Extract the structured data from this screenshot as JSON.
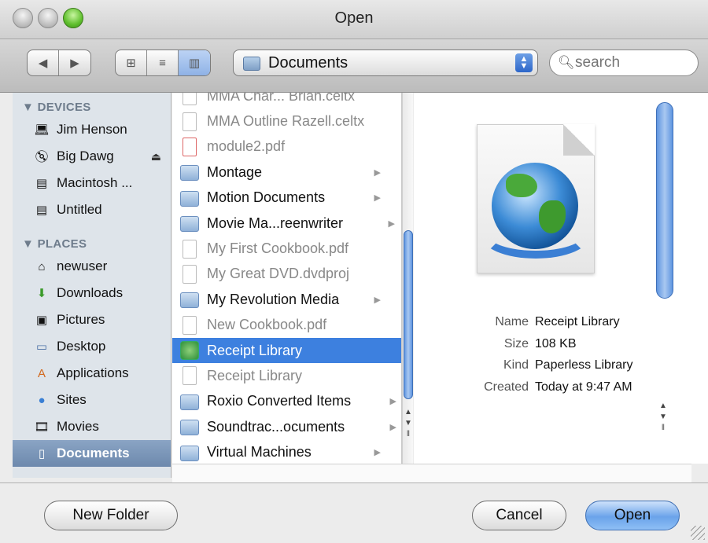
{
  "window": {
    "title": "Open"
  },
  "toolbar": {
    "back_icon": "back-arrow-icon",
    "forward_icon": "forward-arrow-icon",
    "views": [
      "icon-view",
      "list-view",
      "column-view"
    ],
    "active_view": "column-view",
    "location": "Documents",
    "search_placeholder": "search"
  },
  "sidebar": {
    "devices_heading": "DEVICES",
    "devices": [
      {
        "label": "Jim Henson",
        "icon": "laptop-icon"
      },
      {
        "label": "Big Dawg",
        "icon": "disk-icon",
        "eject": "⏏"
      },
      {
        "label": "Macintosh ...",
        "icon": "harddrive-icon"
      },
      {
        "label": "Untitled",
        "icon": "harddrive-icon"
      }
    ],
    "places_heading": "PLACES",
    "places": [
      {
        "label": "newuser",
        "icon": "home-icon"
      },
      {
        "label": "Downloads",
        "icon": "downloads-icon"
      },
      {
        "label": "Pictures",
        "icon": "pictures-icon"
      },
      {
        "label": "Desktop",
        "icon": "desktop-icon"
      },
      {
        "label": "Applications",
        "icon": "applications-icon"
      },
      {
        "label": "Sites",
        "icon": "sites-icon"
      },
      {
        "label": "Movies",
        "icon": "movies-icon"
      },
      {
        "label": "Documents",
        "icon": "documents-icon",
        "selected": true
      }
    ]
  },
  "files": [
    {
      "label": "MMA Char... Brian.celtx",
      "type": "doc",
      "dim": true
    },
    {
      "label": "MMA Outline Razell.celtx",
      "type": "doc",
      "dim": true
    },
    {
      "label": "module2.pdf",
      "type": "pdf",
      "dim": true
    },
    {
      "label": "Montage",
      "type": "folder",
      "arrow": true
    },
    {
      "label": "Motion Documents",
      "type": "folder",
      "arrow": true
    },
    {
      "label": "Movie Ma...reenwriter",
      "type": "folder",
      "arrow": true
    },
    {
      "label": "My First Cookbook.pdf",
      "type": "doc",
      "dim": true
    },
    {
      "label": "My Great DVD.dvdproj",
      "type": "doc",
      "dim": true
    },
    {
      "label": "My Revolution Media",
      "type": "folder",
      "arrow": true
    },
    {
      "label": "New Cookbook.pdf",
      "type": "doc",
      "dim": true
    },
    {
      "label": "Receipt Library",
      "type": "app",
      "selected": true
    },
    {
      "label": "Receipt Library",
      "type": "doc",
      "dim": true
    },
    {
      "label": "Roxio Converted Items",
      "type": "folder",
      "arrow": true
    },
    {
      "label": "Soundtrac...ocuments",
      "type": "folder",
      "arrow": true
    },
    {
      "label": "Virtual Machines",
      "type": "folder",
      "arrow": true
    }
  ],
  "preview": {
    "name_key": "Name",
    "name_val": "Receipt Library",
    "size_key": "Size",
    "size_val": "108 KB",
    "kind_key": "Kind",
    "kind_val": "Paperless Library",
    "created_key": "Created",
    "created_val": "Today at 9:47 AM"
  },
  "buttons": {
    "new_folder": "New Folder",
    "cancel": "Cancel",
    "open": "Open"
  },
  "colors": {
    "selection": "#3d80df",
    "sidebar_bg": "#dee4ea"
  }
}
